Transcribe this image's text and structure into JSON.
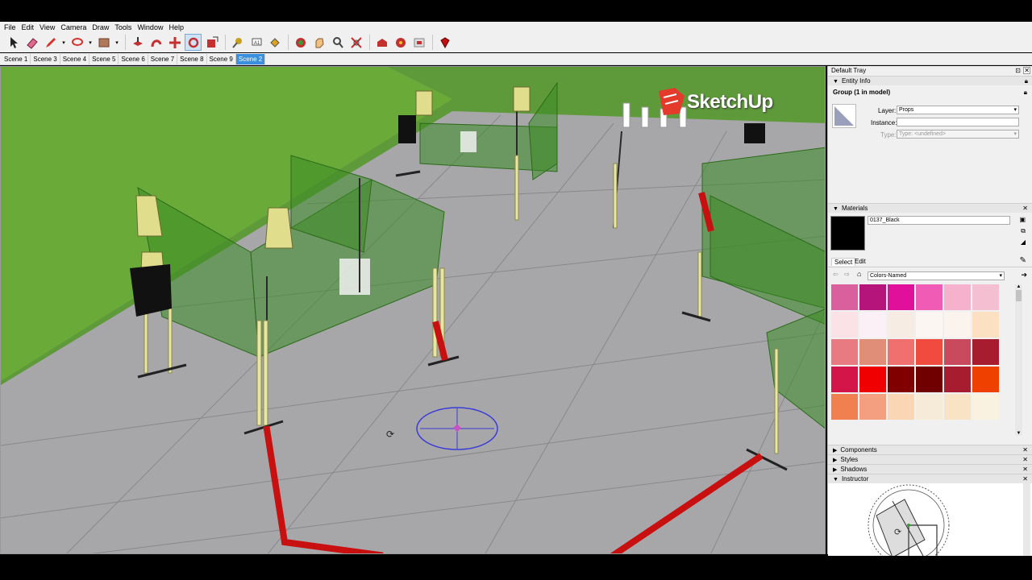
{
  "menu": [
    "File",
    "Edit",
    "View",
    "Camera",
    "Draw",
    "Tools",
    "Window",
    "Help"
  ],
  "toolbar_icons": [
    "select-icon",
    "eraser-icon",
    "pencil-icon",
    "lasso-icon",
    "shape-icon",
    "push-pull-icon",
    "follow-me-icon",
    "move-icon",
    "rotate-icon",
    "scale-icon",
    "tape-measure-icon",
    "text-icon",
    "paint-bucket-icon",
    "orbit-icon",
    "pan-icon",
    "zoom-icon",
    "zoom-extents-icon",
    "warehouse-icon",
    "extension-icon",
    "layout-icon",
    "ruby-icon"
  ],
  "scenes": [
    "Scene 1",
    "Scene 3",
    "Scene 4",
    "Scene 5",
    "Scene 6",
    "Scene 7",
    "Scene 8",
    "Scene 9",
    "Scene 2"
  ],
  "active_scene": "Scene 2",
  "viewport": {
    "logo_text": "SketchUp"
  },
  "tray": {
    "title": "Default Tray",
    "entity_info": {
      "header": "Entity Info",
      "selection": "Group (1 in model)",
      "layer_label": "Layer:",
      "layer_value": "Props",
      "instance_label": "Instance:",
      "instance_value": "",
      "type_label": "Type:",
      "type_value": "Type: <undefined>"
    },
    "materials": {
      "header": "Materials",
      "current_name": "0137_Black",
      "tab_select": "Select",
      "tab_edit": "Edit",
      "library": "Colors-Named",
      "swatches": [
        "#d9609c",
        "#b5157a",
        "#e0109a",
        "#ef5bb5",
        "#f6b2cc",
        "#f4bfd0",
        "#fbe2e6",
        "#fbf0f6",
        "#f7ece4",
        "#fbf6f1",
        "#fbf3ee",
        "#fbe0c2",
        "#e87a82",
        "#e08e78",
        "#f07070",
        "#f04b3e",
        "#c94a5c",
        "#a81c30",
        "#d4154a",
        "#f00000",
        "#800000",
        "#700000",
        "#a81c30",
        "#f04000",
        "#f08050",
        "#f4a080",
        "#fad6b4",
        "#f6ead8",
        "#f8e4c4",
        "#faf2e0"
      ]
    },
    "components_header": "Components",
    "styles_header": "Styles",
    "shadows_header": "Shadows",
    "instructor_header": "Instructor"
  }
}
